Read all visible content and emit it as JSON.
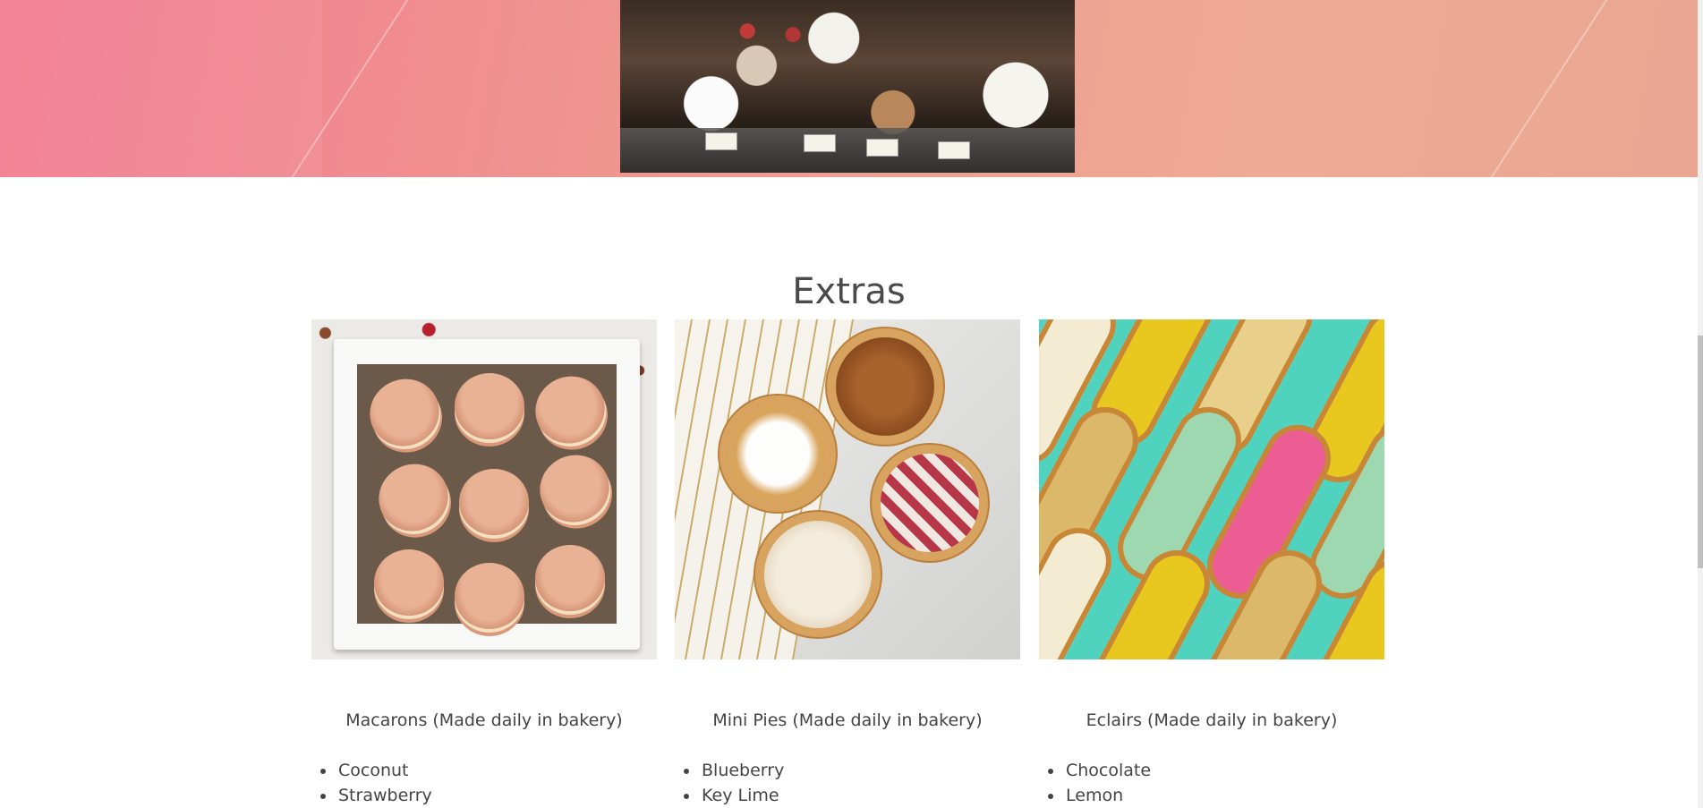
{
  "section": {
    "title": "Extras"
  },
  "items": [
    {
      "caption": "Macarons (Made daily in bakery)",
      "flavors": [
        "Coconut",
        "Strawberry"
      ]
    },
    {
      "caption": "Mini Pies (Made daily in bakery)",
      "flavors": [
        "Blueberry",
        "Key Lime"
      ]
    },
    {
      "caption": "Eclairs (Made daily in bakery)",
      "flavors": [
        "Chocolate",
        "Lemon"
      ]
    }
  ],
  "colors": {
    "hero_gradient_start": "#f27c91",
    "hero_gradient_end": "#e9a692",
    "text": "#444444",
    "eclair_background": "#4fd3bf"
  }
}
